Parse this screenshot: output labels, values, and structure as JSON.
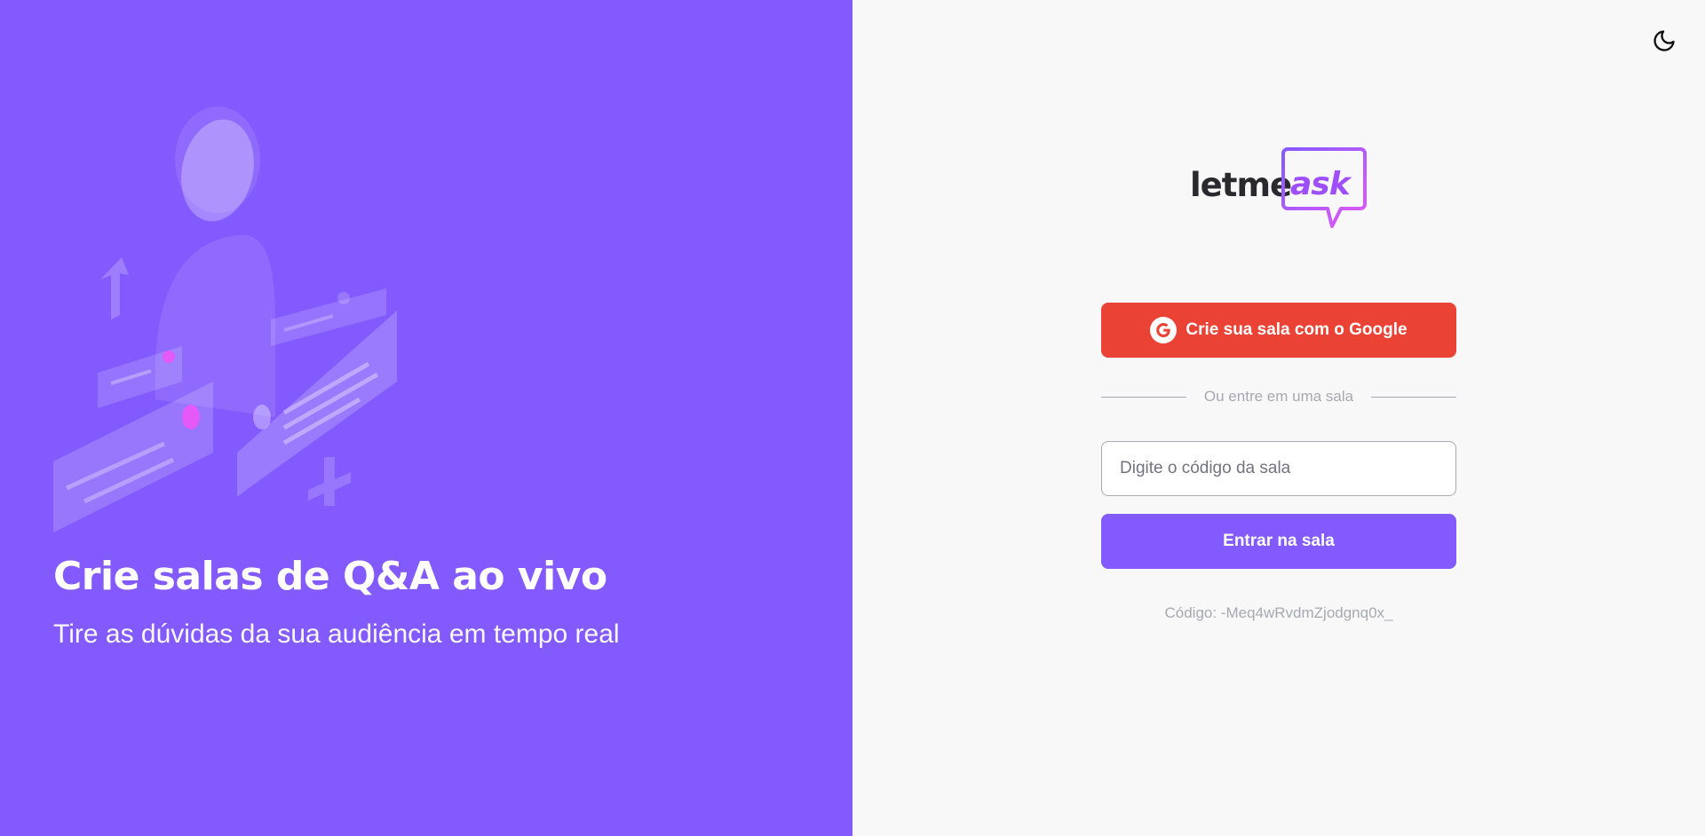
{
  "aside": {
    "illustration": "qa-illustration",
    "title": "Crie salas de Q&A ao vivo",
    "subtitle": "Tire as dúvidas da sua audiência em tempo real"
  },
  "header": {
    "theme_toggle_icon": "moon-icon"
  },
  "logo": {
    "part1": "letme",
    "part2": "ask"
  },
  "google_button": {
    "icon": "google-icon",
    "label": "Crie sua sala com o Google"
  },
  "separator": {
    "text": "Ou entre em uma sala"
  },
  "room_form": {
    "input_placeholder": "Digite o código da sala",
    "input_value": "",
    "submit_label": "Entrar na sala"
  },
  "room_code_text": "Código: -Meq4wRvdmZjodgnq0x_",
  "colors": {
    "primary": "#835afd",
    "google_red": "#ea4335",
    "background": "#f8f8f8",
    "text_dark": "#29292e",
    "muted": "#a8a8b3"
  }
}
